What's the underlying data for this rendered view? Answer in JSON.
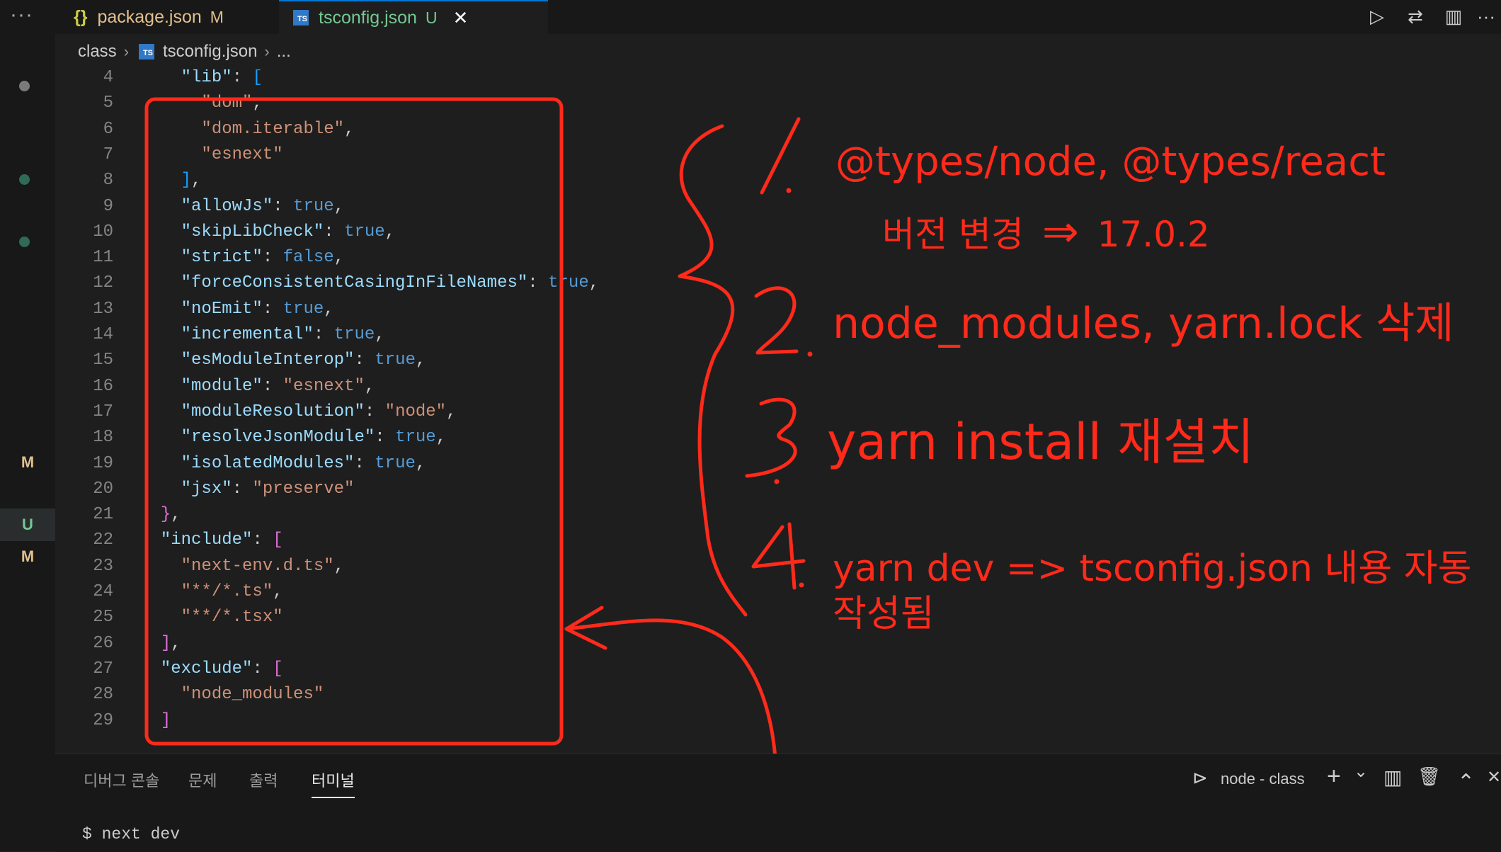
{
  "tabs": [
    {
      "icon": "{}",
      "label": "package.json",
      "flag": "M",
      "flag_color": "#e2c08d"
    },
    {
      "icon": "TS",
      "label": "tsconfig.json",
      "flag": "U",
      "flag_color": "#73c991",
      "close": "✕"
    }
  ],
  "toolbar": {
    "run": "▷",
    "compare": "⇄",
    "split": "▥",
    "more": "···"
  },
  "activity": {
    "menu": "···",
    "marks": [
      "M",
      "U",
      "M"
    ]
  },
  "breadcrumb": {
    "folder": "class",
    "file": "tsconfig.json",
    "more": "..."
  },
  "editor": {
    "lines": [
      {
        "n": "4",
        "t": [
          [
            "    ",
            "p"
          ],
          [
            "\"lib\"",
            "k"
          ],
          [
            ": ",
            "p"
          ],
          [
            "[",
            "br3"
          ]
        ]
      },
      {
        "n": "5",
        "t": [
          [
            "      ",
            "p"
          ],
          [
            "\"dom\"",
            "s"
          ],
          [
            ",",
            "p"
          ]
        ]
      },
      {
        "n": "6",
        "t": [
          [
            "      ",
            "p"
          ],
          [
            "\"dom.iterable\"",
            "s"
          ],
          [
            ",",
            "p"
          ]
        ]
      },
      {
        "n": "7",
        "t": [
          [
            "      ",
            "p"
          ],
          [
            "\"esnext\"",
            "s"
          ]
        ]
      },
      {
        "n": "8",
        "t": [
          [
            "    ",
            "p"
          ],
          [
            "]",
            "br3"
          ],
          [
            ",",
            "p"
          ]
        ]
      },
      {
        "n": "9",
        "t": [
          [
            "    ",
            "p"
          ],
          [
            "\"allowJs\"",
            "k"
          ],
          [
            ": ",
            "p"
          ],
          [
            "true",
            "b"
          ],
          [
            ",",
            "p"
          ]
        ]
      },
      {
        "n": "10",
        "t": [
          [
            "    ",
            "p"
          ],
          [
            "\"skipLibCheck\"",
            "k"
          ],
          [
            ": ",
            "p"
          ],
          [
            "true",
            "b"
          ],
          [
            ",",
            "p"
          ]
        ]
      },
      {
        "n": "11",
        "t": [
          [
            "    ",
            "p"
          ],
          [
            "\"strict\"",
            "k"
          ],
          [
            ": ",
            "p"
          ],
          [
            "false",
            "b"
          ],
          [
            ",",
            "p"
          ]
        ]
      },
      {
        "n": "12",
        "t": [
          [
            "    ",
            "p"
          ],
          [
            "\"forceConsistentCasingInFileNames\"",
            "k"
          ],
          [
            ": ",
            "p"
          ],
          [
            "true",
            "b"
          ],
          [
            ",",
            "p"
          ]
        ]
      },
      {
        "n": "13",
        "t": [
          [
            "    ",
            "p"
          ],
          [
            "\"noEmit\"",
            "k"
          ],
          [
            ": ",
            "p"
          ],
          [
            "true",
            "b"
          ],
          [
            ",",
            "p"
          ]
        ]
      },
      {
        "n": "14",
        "t": [
          [
            "    ",
            "p"
          ],
          [
            "\"incremental\"",
            "k"
          ],
          [
            ": ",
            "p"
          ],
          [
            "true",
            "b"
          ],
          [
            ",",
            "p"
          ]
        ]
      },
      {
        "n": "15",
        "t": [
          [
            "    ",
            "p"
          ],
          [
            "\"esModuleInterop\"",
            "k"
          ],
          [
            ": ",
            "p"
          ],
          [
            "true",
            "b"
          ],
          [
            ",",
            "p"
          ]
        ]
      },
      {
        "n": "16",
        "t": [
          [
            "    ",
            "p"
          ],
          [
            "\"module\"",
            "k"
          ],
          [
            ": ",
            "p"
          ],
          [
            "\"esnext\"",
            "s"
          ],
          [
            ",",
            "p"
          ]
        ]
      },
      {
        "n": "17",
        "t": [
          [
            "    ",
            "p"
          ],
          [
            "\"moduleResolution\"",
            "k"
          ],
          [
            ": ",
            "p"
          ],
          [
            "\"node\"",
            "s"
          ],
          [
            ",",
            "p"
          ]
        ]
      },
      {
        "n": "18",
        "t": [
          [
            "    ",
            "p"
          ],
          [
            "\"resolveJsonModule\"",
            "k"
          ],
          [
            ": ",
            "p"
          ],
          [
            "true",
            "b"
          ],
          [
            ",",
            "p"
          ]
        ]
      },
      {
        "n": "19",
        "t": [
          [
            "    ",
            "p"
          ],
          [
            "\"isolatedModules\"",
            "k"
          ],
          [
            ": ",
            "p"
          ],
          [
            "true",
            "b"
          ],
          [
            ",",
            "p"
          ]
        ]
      },
      {
        "n": "20",
        "t": [
          [
            "    ",
            "p"
          ],
          [
            "\"jsx\"",
            "k"
          ],
          [
            ": ",
            "p"
          ],
          [
            "\"preserve\"",
            "s"
          ]
        ]
      },
      {
        "n": "21",
        "t": [
          [
            "  ",
            "p"
          ],
          [
            "}",
            "br2"
          ],
          [
            ",",
            "p"
          ]
        ]
      },
      {
        "n": "22",
        "t": [
          [
            "  ",
            "p"
          ],
          [
            "\"include\"",
            "k"
          ],
          [
            ": ",
            "p"
          ],
          [
            "[",
            "br2"
          ]
        ]
      },
      {
        "n": "23",
        "t": [
          [
            "    ",
            "p"
          ],
          [
            "\"next-env.d.ts\"",
            "s"
          ],
          [
            ",",
            "p"
          ]
        ]
      },
      {
        "n": "24",
        "t": [
          [
            "    ",
            "p"
          ],
          [
            "\"**/*.ts\"",
            "s"
          ],
          [
            ",",
            "p"
          ]
        ]
      },
      {
        "n": "25",
        "t": [
          [
            "    ",
            "p"
          ],
          [
            "\"**/*.tsx\"",
            "s"
          ]
        ]
      },
      {
        "n": "26",
        "t": [
          [
            "  ",
            "p"
          ],
          [
            "]",
            "br2"
          ],
          [
            ",",
            "p"
          ]
        ]
      },
      {
        "n": "27",
        "t": [
          [
            "  ",
            "p"
          ],
          [
            "\"exclude\"",
            "k"
          ],
          [
            ": ",
            "p"
          ],
          [
            "[",
            "br2"
          ]
        ]
      },
      {
        "n": "28",
        "t": [
          [
            "    ",
            "p"
          ],
          [
            "\"node_modules\"",
            "s"
          ]
        ]
      },
      {
        "n": "29",
        "t": [
          [
            "  ",
            "p"
          ],
          [
            "]",
            "br2"
          ]
        ]
      }
    ]
  },
  "annotations": {
    "n1": "1.",
    "line1": "@types/node, @types/react",
    "line1b_text": "버전 변경",
    "line1b_arrow": "⇒",
    "line1b_ver": "17.0.2",
    "n2": "2.",
    "line2": "node_modules, yarn.lock 삭제",
    "n3": "3.",
    "line3": "yarn install 재설치",
    "n4": "4.",
    "line4a": "yarn dev => tsconfig.json 내용 자동",
    "line4b": "작성됨",
    "color": "#ff2a1a"
  },
  "panel": {
    "tabs": [
      "디버그 콘솔",
      "문제",
      "출력",
      "터미널"
    ],
    "terminal_name": "node - class",
    "icons": {
      "term": "⊳",
      "add": "+",
      "drop": "⌄",
      "split": "▥",
      "trash": "🗑",
      "up": "⌃",
      "close": "✕"
    },
    "terminal_line": "$ next dev"
  }
}
